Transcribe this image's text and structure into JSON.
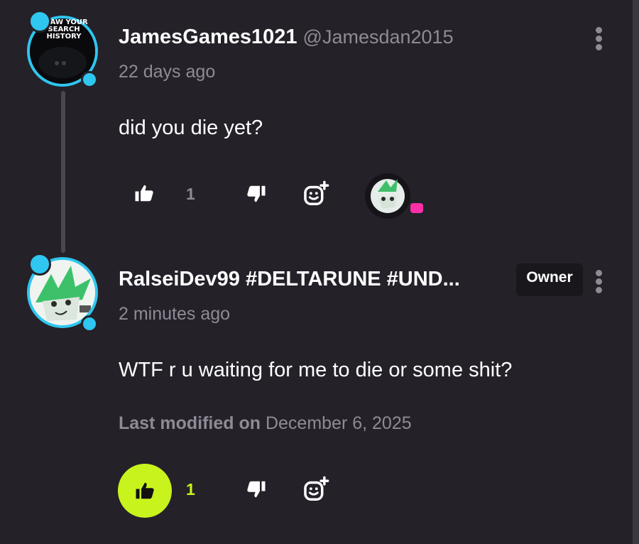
{
  "comments": [
    {
      "author": "JamesGames1021",
      "handle": "@Jamesdan2015",
      "time": "22 days ago",
      "text": "did you die yet?",
      "likes": "1",
      "avatar_caption": "I SAW YOUR SEARCH HISTORY"
    },
    {
      "author": "RalseiDev99 #DELTARUNE #UND...",
      "badge": "Owner",
      "time": "2 minutes ago",
      "text": "WTF r u waiting for me to die or some shit?",
      "modified_label": "Last modified on",
      "modified_date": "December 6, 2025",
      "likes": "1",
      "liked": true
    }
  ],
  "colors": {
    "background": "#242129",
    "accent_like": "#c8f31d",
    "avatar_ring": "#2fc6ef",
    "reply_indicator": "#ff2fa8",
    "muted_text": "#8f8b96"
  },
  "icons": [
    "thumbs-up-icon",
    "thumbs-down-icon",
    "add-reaction-icon",
    "more-options-icon",
    "reply-indicator-icon"
  ]
}
